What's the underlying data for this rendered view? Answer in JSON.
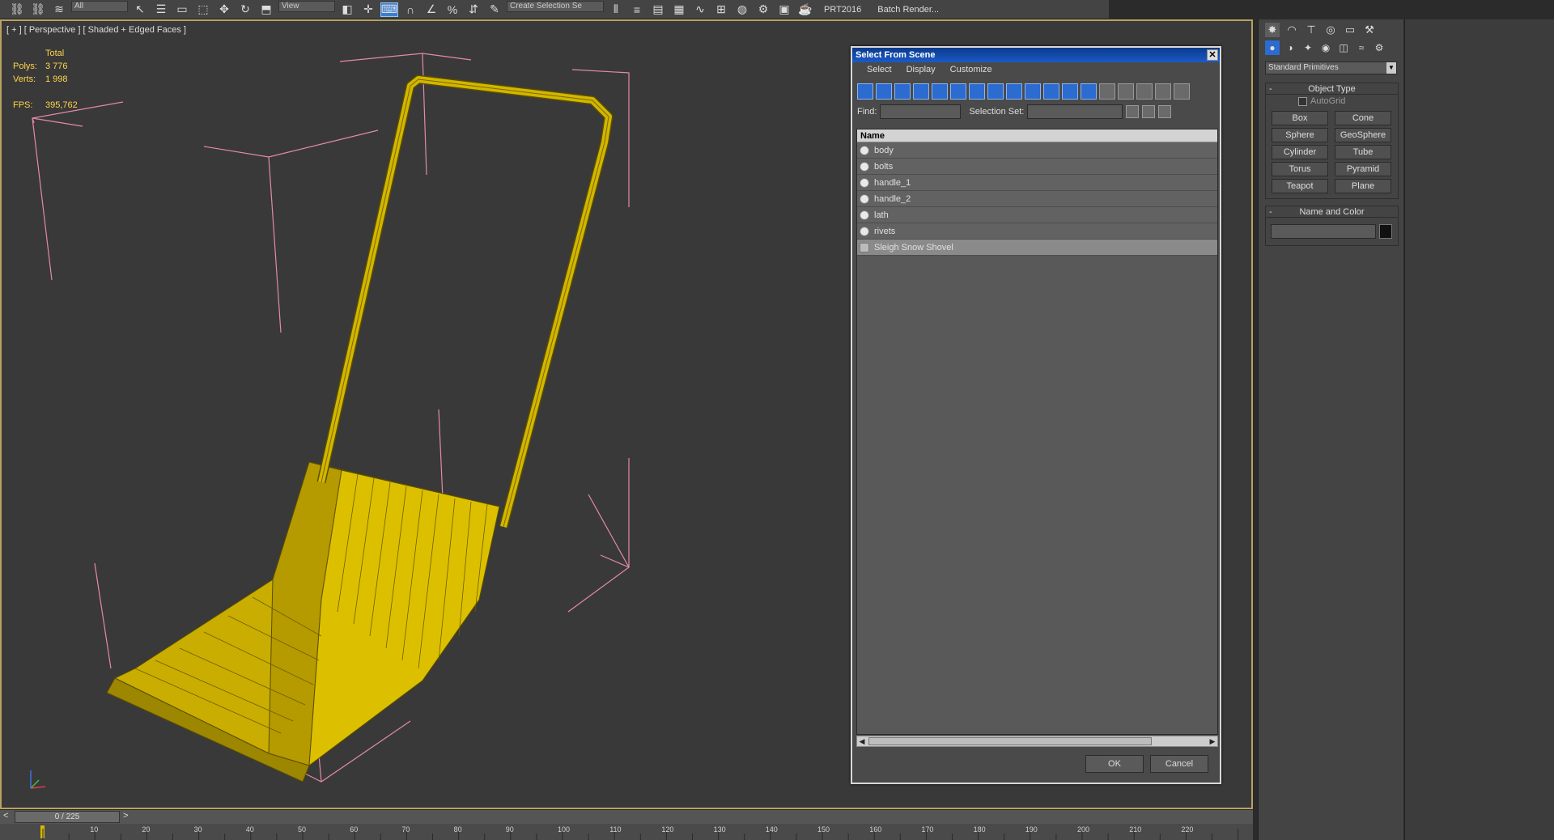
{
  "toolbar": {
    "combo_all": "All",
    "combo_view": "View",
    "combo_selection": "Create Selection Se",
    "prt_label": "PRT2016",
    "render_label": "Batch Render..."
  },
  "viewport": {
    "label": "[ + ] [ Perspective ] [ Shaded + Edged Faces ]",
    "stats": {
      "total_label": "Total",
      "polys_label": "Polys:",
      "polys_value": "3 776",
      "verts_label": "Verts:",
      "verts_value": "1 998",
      "fps_label": "FPS:",
      "fps_value": "395,762"
    },
    "model_color": "#d4b800"
  },
  "dialog": {
    "title": "Select From Scene",
    "close_glyph": "✕",
    "menu": [
      "Select",
      "Display",
      "Customize"
    ],
    "find_label": "Find:",
    "selection_set_label": "Selection Set:",
    "list_header": "Name",
    "items": [
      {
        "label": "body",
        "selected": false
      },
      {
        "label": "bolts",
        "selected": false
      },
      {
        "label": "handle_1",
        "selected": false
      },
      {
        "label": "handle_2",
        "selected": false
      },
      {
        "label": "lath",
        "selected": false
      },
      {
        "label": "rivets",
        "selected": false
      },
      {
        "label": "Sleigh Snow Shovel",
        "selected": true
      }
    ],
    "ok_label": "OK",
    "cancel_label": "Cancel"
  },
  "command_panel": {
    "category": "Standard Primitives",
    "object_type_title": "Object Type",
    "autogrid_label": "AutoGrid",
    "primitives": [
      "Box",
      "Cone",
      "Sphere",
      "GeoSphere",
      "Cylinder",
      "Tube",
      "Torus",
      "Pyramid",
      "Teapot",
      "Plane"
    ],
    "name_color_title": "Name and Color",
    "swatch_color": "#111111"
  },
  "timeline": {
    "frame_display": "0 / 225",
    "ticks": [
      "10",
      "20",
      "30",
      "40",
      "50",
      "60",
      "70",
      "80",
      "90",
      "100",
      "110",
      "120",
      "130",
      "140",
      "150",
      "160",
      "170",
      "180",
      "190",
      "200",
      "210",
      "220"
    ]
  }
}
